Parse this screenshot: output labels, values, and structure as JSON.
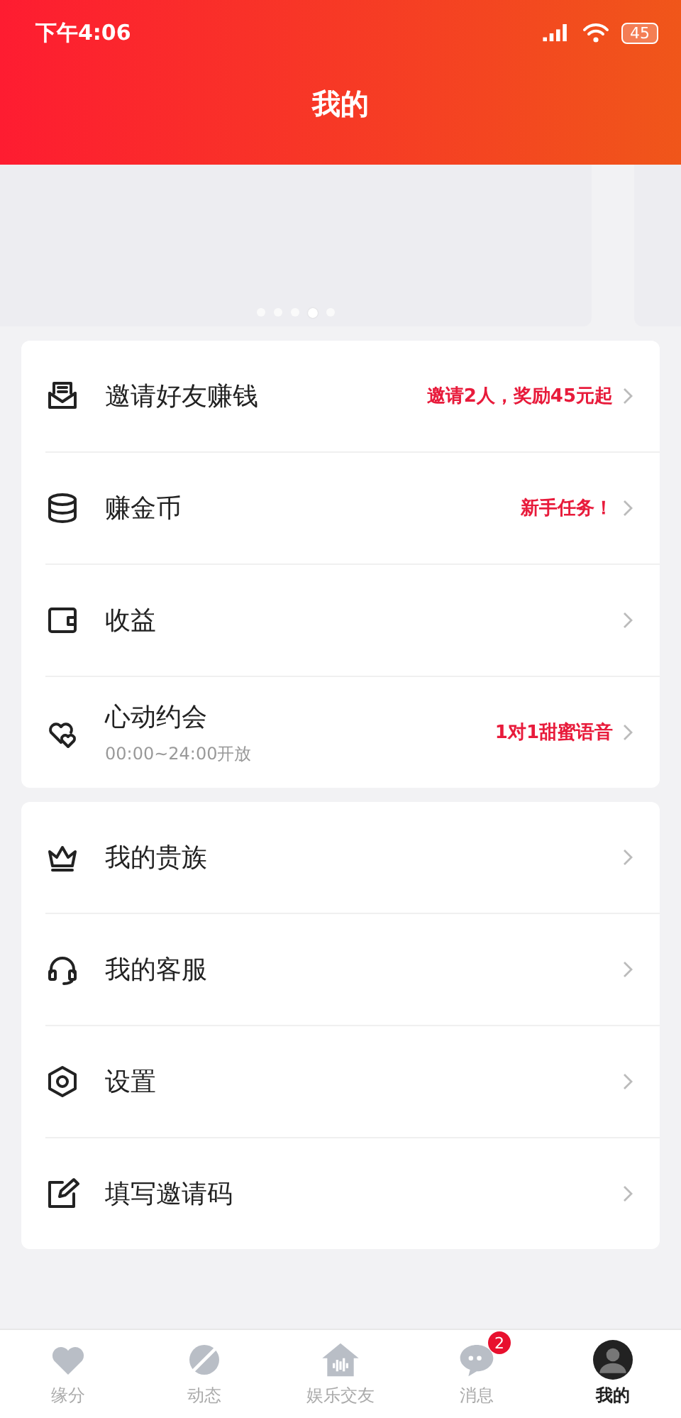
{
  "status_bar": {
    "time": "下午4:06",
    "battery": "45"
  },
  "header": {
    "title": "我的"
  },
  "banner": {
    "dots": [
      {
        "selected": false
      },
      {
        "selected": false
      },
      {
        "selected": false
      },
      {
        "selected": true
      },
      {
        "selected": false
      }
    ]
  },
  "sections": [
    {
      "items": [
        {
          "title": "邀请好友赚钱",
          "note": "邀请2人，奖励45元起"
        },
        {
          "title": "赚金币",
          "note": "新手任务！"
        },
        {
          "title": "收益"
        },
        {
          "title": "心动约会",
          "subtitle": "00:00~24:00开放",
          "note": "1对1甜蜜语音"
        }
      ]
    },
    {
      "items": [
        {
          "title": "我的贵族"
        },
        {
          "title": "我的客服"
        },
        {
          "title": "设置"
        },
        {
          "title": "填写邀请码"
        }
      ]
    }
  ],
  "tab_bar": [
    {
      "label": "缘分",
      "selected": false
    },
    {
      "label": "动态",
      "selected": false
    },
    {
      "label": "娱乐交友",
      "selected": false
    },
    {
      "label": "消息",
      "selected": false,
      "badge": "2"
    },
    {
      "label": "我的",
      "selected": true
    }
  ]
}
